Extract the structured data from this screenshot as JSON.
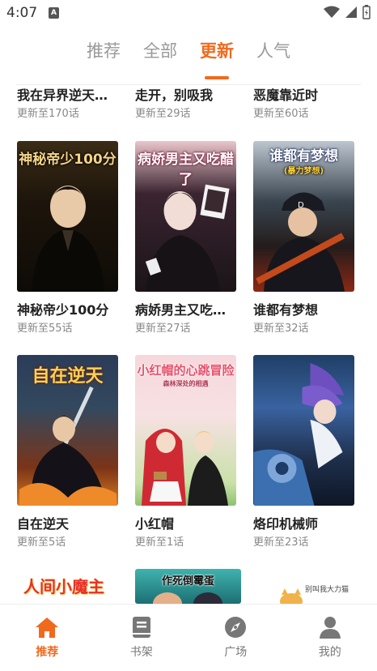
{
  "status_bar": {
    "time": "4:07",
    "indicator": "A"
  },
  "tabs": [
    {
      "label": "推荐",
      "active": false
    },
    {
      "label": "全部",
      "active": false
    },
    {
      "label": "更新",
      "active": true
    },
    {
      "label": "人气",
      "active": false
    }
  ],
  "top_row": [
    {
      "title": "我在异界逆天…",
      "update": "更新至170话"
    },
    {
      "title": "走开，别吸我",
      "update": "更新至29话"
    },
    {
      "title": "恶魔靠近时",
      "update": "更新至60话"
    }
  ],
  "row2": [
    {
      "title": "神秘帝少100分",
      "update": "更新至55话",
      "cover_text": "神秘帝少100分"
    },
    {
      "title": "病娇男主又吃…",
      "update": "更新至27话",
      "cover_text": "病娇男主又吃醋了"
    },
    {
      "title": "谁都有梦想",
      "update": "更新至32话",
      "cover_text": "谁都有梦想",
      "cover_subtext": "(暴力梦想)"
    }
  ],
  "row3": [
    {
      "title": "自在逆天",
      "update": "更新至5话",
      "cover_text": "自在逆天"
    },
    {
      "title": "小红帽",
      "update": "更新至1话",
      "cover_text": "小红帽的心跳冒险",
      "cover_subtext": "森林深处的相遇"
    },
    {
      "title": "烙印机械师",
      "update": "更新至23话",
      "cover_text": ""
    }
  ],
  "partial_row": [
    {
      "cover_text": "人间小魔主"
    },
    {
      "cover_text": "作死倒霉蛋"
    },
    {
      "cover_text": "别叫我大力猫"
    }
  ],
  "bottom_nav": [
    {
      "label": "推荐",
      "icon": "home-icon",
      "active": true
    },
    {
      "label": "书架",
      "icon": "book-icon",
      "active": false
    },
    {
      "label": "广场",
      "icon": "compass-icon",
      "active": false
    },
    {
      "label": "我的",
      "icon": "user-icon",
      "active": false
    }
  ],
  "colors": {
    "accent": "#f06a1e",
    "muted": "#999999",
    "title": "#222222",
    "sub": "#888888"
  }
}
